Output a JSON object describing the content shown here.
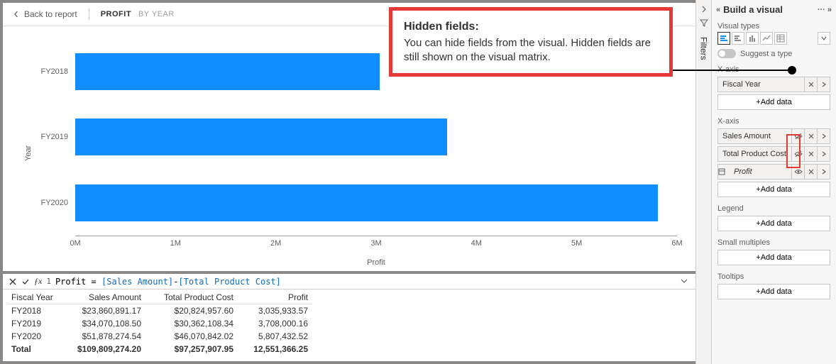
{
  "topbar": {
    "back_label": "Back to report",
    "crumb1": "PROFIT",
    "crumb2": "BY YEAR"
  },
  "callout": {
    "title": "Hidden fields:",
    "body": "You can hide fields from the visual. Hidden fields are still shown on the visual matrix."
  },
  "chart_data": {
    "type": "bar",
    "orientation": "horizontal",
    "categories": [
      "FY2018",
      "FY2019",
      "FY2020"
    ],
    "values": [
      3035933.57,
      3708000.16,
      5807432.52
    ],
    "xlabel": "Profit",
    "ylabel": "Year",
    "xlim": [
      0,
      6000000
    ],
    "x_ticks": [
      "0M",
      "1M",
      "2M",
      "3M",
      "4M",
      "5M",
      "6M"
    ],
    "bar_color": "#118dff"
  },
  "formula": {
    "line_no": "1",
    "measure_name": "Profit",
    "eq": " = ",
    "ref1": "[Sales Amount]",
    "minus": "-",
    "ref2": "[Total Product Cost]"
  },
  "table": {
    "columns": [
      "Fiscal Year",
      "Sales Amount",
      "Total Product Cost",
      "Profit"
    ],
    "rows": [
      {
        "fy": "FY2018",
        "sa": "$23,860,891.17",
        "tpc": "$20,824,957.60",
        "p": "3,035,933.57"
      },
      {
        "fy": "FY2019",
        "sa": "$34,070,108.50",
        "tpc": "$30,362,108.34",
        "p": "3,708,000.16"
      },
      {
        "fy": "FY2020",
        "sa": "$51,878,274.54",
        "tpc": "$46,070,842.02",
        "p": "5,807,432.52"
      }
    ],
    "total": {
      "fy": "Total",
      "sa": "$109,809,274.20",
      "tpc": "$97,257,907.95",
      "p": "12,551,366.25"
    }
  },
  "filters_rail": {
    "label": "Filters"
  },
  "build": {
    "title": "Build a visual",
    "visual_types_label": "Visual types",
    "suggest_label": "Suggest a type",
    "add_data_label": "+Add data",
    "wells": {
      "xaxis1": {
        "label": "X-axis",
        "fields": [
          {
            "name": "Fiscal Year",
            "hidden": false,
            "measure": false
          }
        ]
      },
      "xaxis2": {
        "label": "X-axis",
        "fields": [
          {
            "name": "Sales Amount",
            "hidden": true,
            "measure": false
          },
          {
            "name": "Total Product Cost",
            "hidden": true,
            "measure": false
          },
          {
            "name": "Profit",
            "hidden": false,
            "measure": true
          }
        ]
      },
      "legend": {
        "label": "Legend"
      },
      "small_multiples": {
        "label": "Small multiples"
      },
      "tooltips": {
        "label": "Tooltips"
      }
    }
  }
}
